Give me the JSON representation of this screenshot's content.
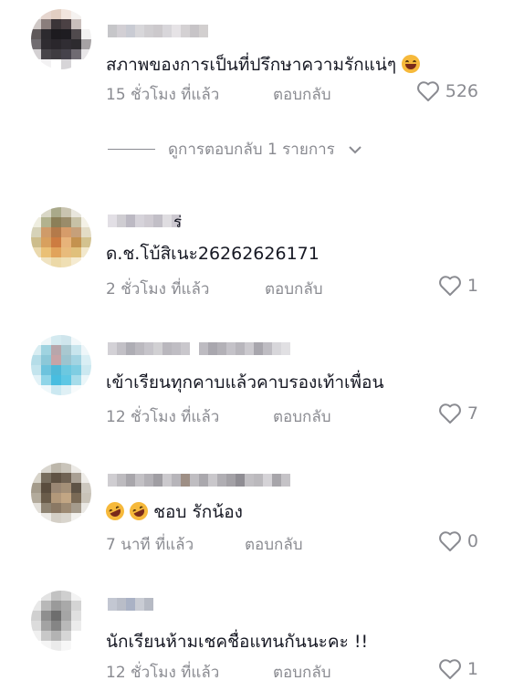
{
  "comments": [
    {
      "avatar_colors": [
        "#f0ebe8",
        "#e6d6cf",
        "#e2cfc3",
        "#f1e5de",
        "#f5f2f0",
        "#ffffff",
        "#cfc8c6",
        "#8a7e7c",
        "#3b3538",
        "#4b4144",
        "#c9bfbc",
        "#ffffff",
        "#5f595a",
        "#2c2a2e",
        "#1d1b1f",
        "#1e1c21",
        "#504a4d",
        "#f2f1f1",
        "#706c70",
        "#2f2c31",
        "#2a272c",
        "#302d33",
        "#2d2b2f",
        "#a6a2a4",
        "#d4d1d3",
        "#48454a",
        "#3f3c41",
        "#45424b",
        "#6f6b72",
        "#e8e6e8",
        "#ffffff",
        "#f3f2f3",
        "#ffffff",
        "#d7d5d8",
        "#ffffff",
        "#ffffff"
      ],
      "name_colors": [
        "#c6c6c9",
        "#d2cfd4",
        "#c9cbd3",
        "#d8d7da",
        "#d0ced1",
        "#ccc9cc",
        "#d8d6da",
        "#e6e3e6",
        "#d4d1d3",
        "#c7c4c7",
        "#d2cfcf"
      ],
      "name_suffix": "",
      "text": "สภาพของการเป็นที่ปรึกษาความรักแน่ๆ",
      "emojis": [
        "laugh"
      ],
      "time": "15 ชั่วโมง ที่แล้ว",
      "reply": "ตอบกลับ",
      "likes": "526"
    },
    {
      "avatar_colors": [
        "#ffffff",
        "#d9d7c6",
        "#a9a98a",
        "#c9c4b0",
        "#e8e6dd",
        "#ffffff",
        "#eeeddf",
        "#b2b28e",
        "#8b7f58",
        "#9a8c6a",
        "#c7c1a6",
        "#f4f1e6",
        "#d6d2b8",
        "#cf9b69",
        "#b47a4a",
        "#d69c6a",
        "#c6a07a",
        "#e3dcc6",
        "#cdbd8c",
        "#d8a05e",
        "#cd7c41",
        "#e7b37a",
        "#c4924f",
        "#d3c28f",
        "#ead9ae",
        "#eac076",
        "#e1a35b",
        "#e8bb7c",
        "#e0c07c",
        "#f2e8cc",
        "#ffffff",
        "#f0e3c1",
        "#ecd9a8",
        "#efdfb4",
        "#f5ebd1",
        "#ffffff"
      ],
      "name_colors": [
        "#e2dfe5",
        "#cfcdd2",
        "#bcb9c3",
        "#d6d3da",
        "#cfcbd2",
        "#c2bfc7",
        "#dfdde1",
        "#ccc8d0"
      ],
      "name_suffix": "ร่",
      "text": "ด.ช.โบ้สิเนะ26262626171",
      "emojis": [],
      "time": "2 ชั่วโมง ที่แล้ว",
      "reply": "ตอบกลับ",
      "likes": "1"
    },
    {
      "avatar_colors": [
        "#ffffff",
        "#eef6f8",
        "#d4eaf0",
        "#cfe5ec",
        "#f2f8fa",
        "#ffffff",
        "#d8edf2",
        "#9fd3e0",
        "#b8a6ab",
        "#a9c8d0",
        "#c8e5ed",
        "#eef6f9",
        "#b5dde8",
        "#8cc8d8",
        "#c6a4a7",
        "#9cc4cf",
        "#a3d4e2",
        "#d9eef4",
        "#c3e4ed",
        "#6dc3dd",
        "#50b9d8",
        "#6cc8e0",
        "#7fcde2",
        "#cbe8f0",
        "#e2f2f7",
        "#8fd5e8",
        "#48bde0",
        "#5ec7e4",
        "#a6dcea",
        "#eaf6f9",
        "#ffffff",
        "#eff8fb",
        "#cbe8f1",
        "#dff0f5",
        "#f7fbfc",
        "#ffffff"
      ],
      "name_colors": [
        "#d3d1d6",
        "#c2c0c6",
        "#aeadb4",
        "#bbb9bf",
        "#c6c4ca",
        "#d1d0d3",
        "#b9b7bd",
        "#bfbdc3",
        "#c9c7cc",
        "#ffffff",
        "#bdbbc1",
        "#a9a7ae",
        "#b3b1b7",
        "#c4c2c8",
        "#b8b6bc",
        "#cbc9ce",
        "#a8a6ad",
        "#bebcc2",
        "#d7d6da",
        "#e1e0e3"
      ],
      "name_suffix": "",
      "text": "เข้าเรียนทุกคาบแล้วคาบรองเท้าเพื่อน",
      "emojis": [],
      "time": "12 ชั่วโมง ที่แล้ว",
      "reply": "ตอบกลับ",
      "likes": "7"
    },
    {
      "avatar_colors": [
        "#ffffff",
        "#d9d6cf",
        "#bdb7ab",
        "#c9c4ba",
        "#eceae6",
        "#ffffff",
        "#d7d3c9",
        "#776d5e",
        "#5f5243",
        "#6f6253",
        "#a9a094",
        "#eeece8",
        "#a49b8b",
        "#5a4d3e",
        "#9a8774",
        "#a49078",
        "#5e5346",
        "#cdc8bf",
        "#b3ab9c",
        "#6a5c4a",
        "#b2987a",
        "#c2a684",
        "#7a6a56",
        "#c9c3b8",
        "#e3e0da",
        "#8f8473",
        "#8a7864",
        "#9d8a73",
        "#a59b8c",
        "#eae8e4",
        "#ffffff",
        "#eceae6",
        "#d4cfc6",
        "#d9d5cd",
        "#f2f1ee",
        "#ffffff"
      ],
      "name_colors": [
        "#cfcdd1",
        "#bdbbbf",
        "#a8a6ab",
        "#c3c1c5",
        "#b3b1b6",
        "#a09ea3",
        "#cbc9cd",
        "#b7b5ba",
        "#9e8f85",
        "#bfbdc1",
        "#aaa8ad",
        "#c9c7cb",
        "#b0aeb3",
        "#a3a1a6",
        "#8f8d93",
        "#c1bfc3",
        "#bbb9bd",
        "#d5d3d7",
        "#a7a5aa",
        "#c5c3c7"
      ],
      "name_suffix": "",
      "text": "ชอบ รักน้อง",
      "emojis": [
        "rofl",
        "rofl"
      ],
      "time": "7 นาที ที่แล้ว",
      "reply": "ตอบกลับ",
      "likes": "0"
    },
    {
      "avatar_colors": [
        "#ffffff",
        "#e3e3e3",
        "#c2c2c2",
        "#cfcfcf",
        "#f3f3f3",
        "#ffffff",
        "#e8e8e8",
        "#b8b8b8",
        "#9a9a9a",
        "#a9a9a9",
        "#d4d4d4",
        "#ffffff",
        "#d0d0d0",
        "#8f8f8f",
        "#6e6e6e",
        "#a5a5a5",
        "#e0e0e0",
        "#ffffff",
        "#dcdcdc",
        "#a3a3a3",
        "#858585",
        "#b9b9b9",
        "#ececec",
        "#ffffff",
        "#f0f0f0",
        "#c8c8c8",
        "#b3b3b3",
        "#d6d6d6",
        "#ffffff",
        "#ffffff",
        "#ffffff",
        "#f5f5f5",
        "#ebebeb",
        "#f7f7f7",
        "#ffffff",
        "#ffffff"
      ],
      "name_colors": [
        "#c3c7d2",
        "#b9bdc8",
        "#aab2c5",
        "#c9ccd4",
        "#b6bac4"
      ],
      "name_suffix": "",
      "text": "นักเรียนห้ามเชคชื่อแทนกันนะคะ !!",
      "emojis": [],
      "time": "12 ชั่วโมง ที่แล้ว",
      "reply": "ตอบกลับ",
      "likes": "1"
    }
  ],
  "view_replies": "ดูการตอบกลับ 1 รายการ",
  "heart_color": "#8a8b91",
  "meta_color": "#8a8b91"
}
